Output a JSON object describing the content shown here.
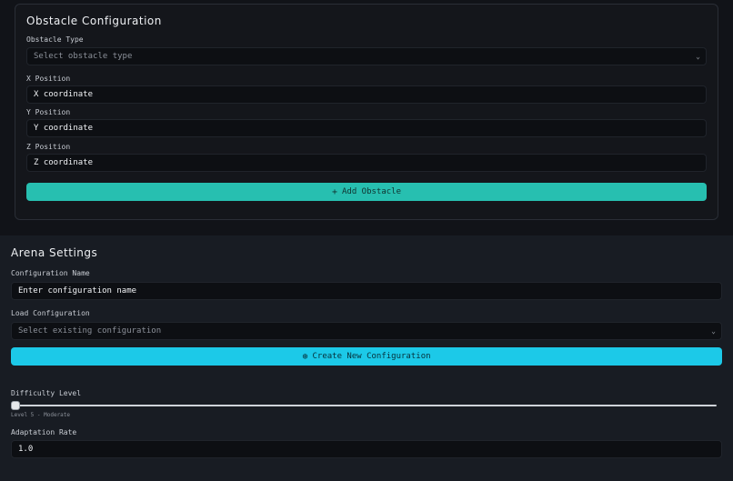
{
  "obstacle": {
    "title": "Obstacle Configuration",
    "type_label": "Obstacle Type",
    "type_placeholder": "Select obstacle type",
    "x_label": "X Position",
    "x_placeholder": "X coordinate",
    "y_label": "Y Position",
    "y_placeholder": "Y coordinate",
    "z_label": "Z Position",
    "z_placeholder": "Z coordinate",
    "add_button": "Add Obstacle"
  },
  "arena": {
    "title": "Arena Settings",
    "name_label": "Configuration Name",
    "name_placeholder": "Enter configuration name",
    "load_label": "Load Configuration",
    "load_placeholder": "Select existing configuration",
    "create_button": "Create New Configuration",
    "difficulty_label": "Difficulty Level",
    "difficulty_hint": "Level 5 - Moderate",
    "difficulty_value": 5,
    "adaptation_label": "Adaptation Rate",
    "adaptation_value": "1.0"
  },
  "icons": {
    "add": "plus-icon",
    "create": "plus-circle-icon",
    "dropdown": "chevron-down-icon"
  },
  "colors": {
    "add_button": "#27bfb0",
    "create_button": "#1cc9e8"
  }
}
